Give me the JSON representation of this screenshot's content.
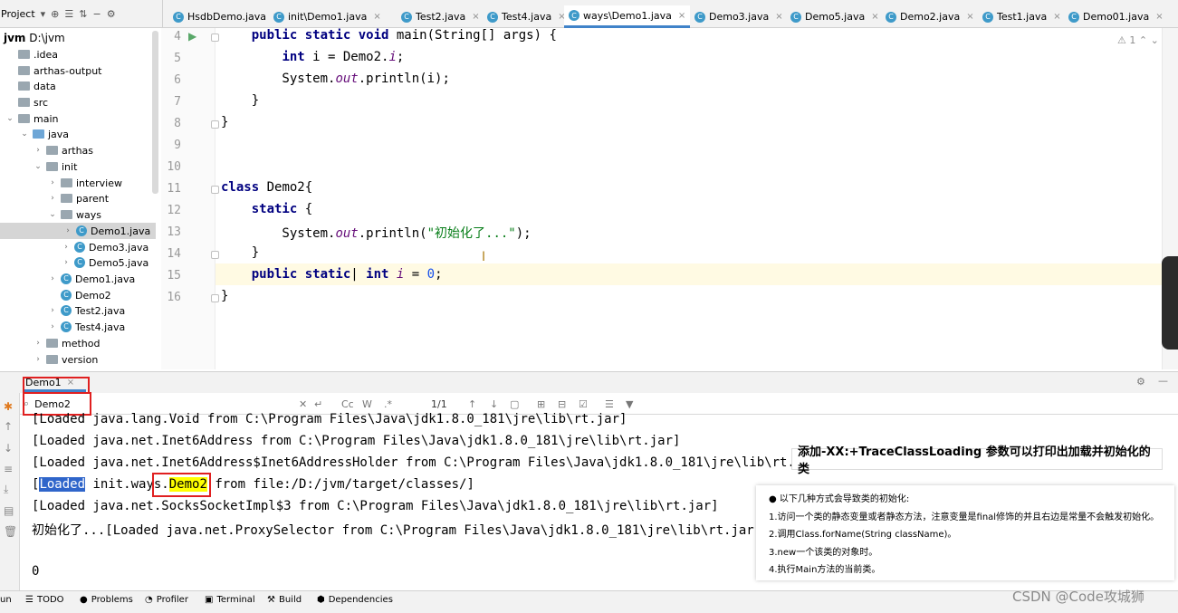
{
  "topbar": {
    "project_label": "Project",
    "tabs": [
      "HsdbDemo.java",
      "init\\Demo1.java",
      "Test2.java",
      "Test4.java",
      "ways\\Demo1.java",
      "Demo3.java",
      "Demo5.java",
      "Demo2.java",
      "Test1.java",
      "Demo01.java"
    ],
    "active_tab": "ways\\Demo1.java"
  },
  "tree": {
    "root_name": "jvm",
    "root_path": "D:\\jvm",
    "items": [
      ".idea",
      "arthas-output",
      "data",
      "src",
      "main",
      "java",
      "arthas",
      "init",
      "interview",
      "parent",
      "ways",
      "Demo1.java",
      "Demo3.java",
      "Demo5.java",
      "Demo1.java",
      "Demo2",
      "Test2.java",
      "Test4.java",
      "method",
      "version"
    ],
    "selected": "Demo1.java"
  },
  "editor": {
    "line_numbers": [
      "4",
      "5",
      "6",
      "7",
      "8",
      "9",
      "10",
      "11",
      "12",
      "13",
      "14",
      "15",
      "16"
    ],
    "warning_count": "1"
  },
  "run": {
    "tab_label": "Demo1",
    "search_value": "Demo2",
    "match_count": "1/1",
    "console_lines": [
      "[Loaded java.lang.Void from C:\\Program Files\\Java\\jdk1.8.0_181\\jre\\lib\\rt.jar]",
      "[Loaded java.net.Inet6Address from C:\\Program Files\\Java\\jdk1.8.0_181\\jre\\lib\\rt.jar]",
      "[Loaded java.net.Inet6Address$Inet6AddressHolder from C:\\Program Files\\Java\\jdk1.8.0_181\\jre\\lib\\rt.jar]",
      "[Loaded init.ways.Demo2 from file:/D:/jvm/target/classes/]",
      "[Loaded java.net.SocksSocketImpl$3 from C:\\Program Files\\Java\\jdk1.8.0_181\\jre\\lib\\rt.jar]",
      "初始化了...[Loaded java.net.ProxySelector from C:\\Program Files\\Java\\jdk1.8.0_181\\jre\\lib\\rt.jar]",
      "0"
    ]
  },
  "annotation": "添加-XX:+TraceClassLoading 参数可以打印出加载并初始化的类",
  "notes": [
    "● 以下几种方式会导致类的初始化:",
    "1.访问一个类的静态变量或者静态方法，注意变量是final修饰的并且右边是常量不会触发初始化。",
    "2.调用Class.forName(String className)。",
    "3.new一个该类的对象时。",
    "4.执行Main方法的当前类。"
  ],
  "bottombar": {
    "items": [
      "TODO",
      "Problems",
      "Profiler",
      "Terminal",
      "Build",
      "Dependencies"
    ],
    "left_cut": "un"
  },
  "watermark": "CSDN @Code攻城狮",
  "colors": {
    "accent": "#4083c9",
    "keyword": "#000080",
    "string": "#067d17",
    "field": "#660e7a",
    "number": "#1750eb",
    "highlight": "#ffff00",
    "annotation_box": "#e02020"
  }
}
